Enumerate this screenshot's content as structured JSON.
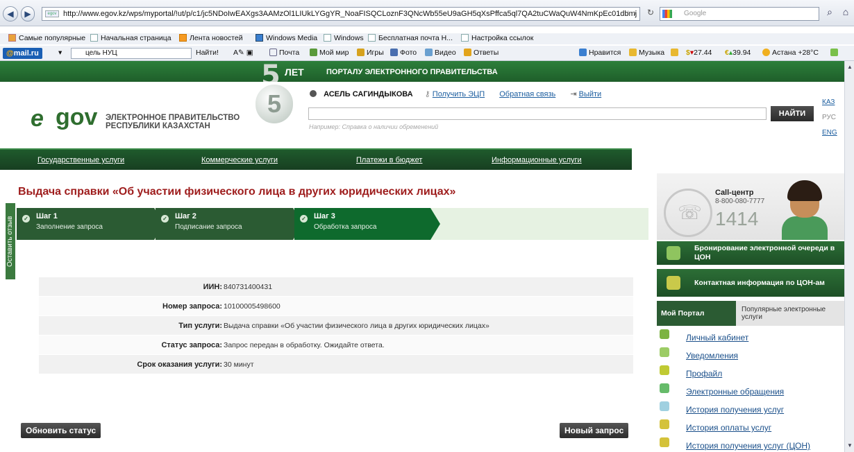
{
  "browser": {
    "url": "http://www.egov.kz/wps/myportal/!ut/p/c1/jc5NDoIwEAXgs3AAMzOl1LIUkLYGgYR_NoaFISQCLoznF3QNcWb55eU9aGH5qXsPffca5ql7QA2tuCWaQuW4NmKpEc01dbmj",
    "favicon_text": "egov",
    "search_placeholder": "Google"
  },
  "bookmarks": [
    {
      "label": "Самые популярные",
      "icon": "star-icon"
    },
    {
      "label": "Начальная страница",
      "icon": "page-icon"
    },
    {
      "label": "Лента новостей",
      "icon": "rss-icon"
    },
    {
      "label": "Windows Media",
      "icon": "windows-media-icon"
    },
    {
      "label": "Windows",
      "icon": "page-icon"
    },
    {
      "label": "Бесплатная почта H...",
      "icon": "page-icon"
    },
    {
      "label": "Настройка ссылок",
      "icon": "page-icon"
    }
  ],
  "mailru_toolbar": {
    "logo_at": "@",
    "logo_text": "mail.ru",
    "search_value": "цель НУЦ",
    "find_label": "Найти!",
    "items": [
      "Почта",
      "Мой мир",
      "Игры",
      "Фото",
      "Видео",
      "Ответы"
    ],
    "likes": "Нравится",
    "music": "Музыка",
    "usd": "27.44",
    "eur": "39.94",
    "weather": "Астана +28°C"
  },
  "site": {
    "banner_number": "5",
    "banner_years": "ЛЕТ",
    "banner_text": "ПОРТАЛУ ЭЛЕКТРОННОГО ПРАВИТЕЛЬСТВА",
    "logo_e": "e",
    "logo_gov": "gov",
    "logo_text": "ЭЛЕКТРОННОЕ ПРАВИТЕЛЬСТВО РЕСПУБЛИКИ КАЗАХСТАН",
    "user_name": "АСЕЛЬ САГИНДЫКОВА",
    "link_eds": "Получить ЭЦП",
    "link_feedback": "Обратная связь",
    "link_logout": "Выйти",
    "search_hint": "Например: Справка о наличии обременений",
    "find_button": "НАЙТИ",
    "langs": [
      "КАЗ",
      "РУС",
      "ENG"
    ],
    "nav": [
      "Государственные услуги",
      "Коммерческие услуги",
      "Платежи в бюджет",
      "Информационные услуги"
    ],
    "feedback_tab": "Оставить отзыв"
  },
  "page": {
    "title": "Выдача справки «Об участии физического лица в других юридических лицах»",
    "steps": [
      {
        "title": "Шаг 1",
        "subtitle": "Заполнение запроса"
      },
      {
        "title": "Шаг 2",
        "subtitle": "Подписание запроса"
      },
      {
        "title": "Шаг 3",
        "subtitle": "Обработка запроса"
      }
    ],
    "info_rows": [
      {
        "key": "ИИН:",
        "value": "840731400431"
      },
      {
        "key": "Номер запроса:",
        "value": "10100005498600"
      },
      {
        "key": "Тип услуги:",
        "value": "Выдача справки «Об участии физического лица в других юридических лицах»"
      },
      {
        "key": "Статус запроса:",
        "value": "Запрос передан в обработку. Ожидайте ответа."
      },
      {
        "key": "Срок оказания услуги:",
        "value": "30 минут"
      }
    ],
    "refresh_button": "Обновить статус",
    "new_request_button": "Новый запрос"
  },
  "sidebar": {
    "callcenter_title": "Call-центр",
    "callcenter_phone": "8-800-080-7777",
    "callcenter_short": "1414",
    "block_queue": "Бронирование электронной очереди в ЦОН",
    "block_contacts": "Контактная информация по ЦОН-ам",
    "tab_my": "Мой Портал",
    "tab_popular": "Популярные электронные услуги",
    "menu": [
      {
        "label": "Личный кабинет",
        "icon": "home-icon",
        "color": "#7cb342"
      },
      {
        "label": "Уведомления",
        "icon": "notification-icon",
        "color": "#9ccc65"
      },
      {
        "label": "Профайл",
        "icon": "profile-icon",
        "color": "#c0ca33"
      },
      {
        "label": "Электронные обращения",
        "icon": "document-icon",
        "color": "#66bb6a"
      },
      {
        "label": "История получения услуг",
        "icon": "history-icon",
        "color": "#9fd0e0"
      },
      {
        "label": "История оплаты услуг",
        "icon": "payment-history-icon",
        "color": "#d4c23a"
      },
      {
        "label": "История получения услуг (ЦОН)",
        "icon": "history-con-icon",
        "color": "#d4c23a"
      }
    ]
  }
}
